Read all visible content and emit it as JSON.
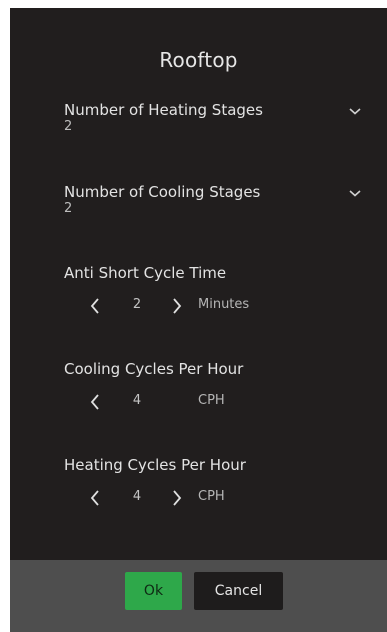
{
  "dialog": {
    "title": "Rooftop"
  },
  "heating_stages": {
    "label": "Number of Heating Stages",
    "value": "2",
    "icon": "chevron-down-icon"
  },
  "cooling_stages": {
    "label": "Number of Cooling Stages",
    "value": "2",
    "icon": "chevron-down-icon"
  },
  "anti_short_cycle": {
    "label": "Anti Short Cycle Time",
    "value": "2",
    "unit": "Minutes"
  },
  "cooling_cph": {
    "label": "Cooling Cycles Per Hour",
    "value": "4",
    "unit": "CPH"
  },
  "heating_cph": {
    "label": "Heating Cycles Per Hour",
    "value": "4",
    "unit": "CPH"
  },
  "footer": {
    "ok_label": "Ok",
    "cancel_label": "Cancel"
  },
  "colors": {
    "dialog_background": "#211e1e",
    "footer_background": "#4e4e4e",
    "ok_button": "#2ea84a",
    "cancel_button": "#1e1c1c",
    "text": "#e3e3e3"
  }
}
